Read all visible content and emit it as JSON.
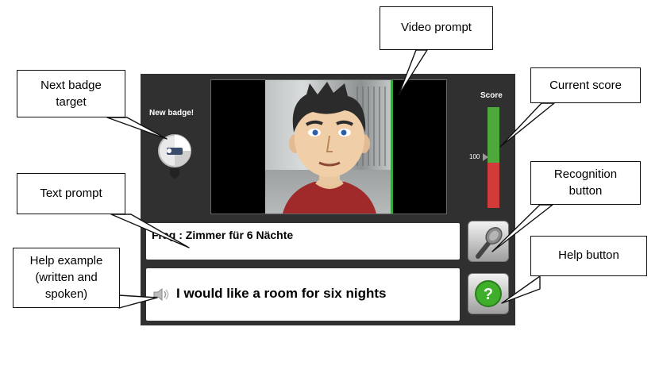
{
  "app": {
    "badge": {
      "label": "New badge!",
      "icon": "badge-wheel-icon"
    },
    "score": {
      "label": "Score",
      "marker_label": "100",
      "level": 0.55,
      "colors": {
        "good": "#4ea93d",
        "bad": "#d33a3a"
      }
    },
    "text_prompt": {
      "text": "Frag : Zimmer für 6 Nächte"
    },
    "help_example": {
      "icon": "speaker-icon",
      "text": "I would like a room for six nights"
    },
    "buttons": {
      "recognition_icon": "microphone-icon",
      "help_icon": "question-mark-icon",
      "help_color": "#3fae2a"
    },
    "video": {
      "content": "avatar-video"
    }
  },
  "callouts": {
    "video_prompt": "Video prompt",
    "next_badge_line1": "Next badge",
    "next_badge_line2": "target",
    "current_score": "Current score",
    "text_prompt": "Text prompt",
    "recognition_line1": "Recognition",
    "recognition_line2": "button",
    "help_example_line1": "Help example",
    "help_example_line2": "(written and",
    "help_example_line3": "spoken)",
    "help_button": "Help button"
  }
}
